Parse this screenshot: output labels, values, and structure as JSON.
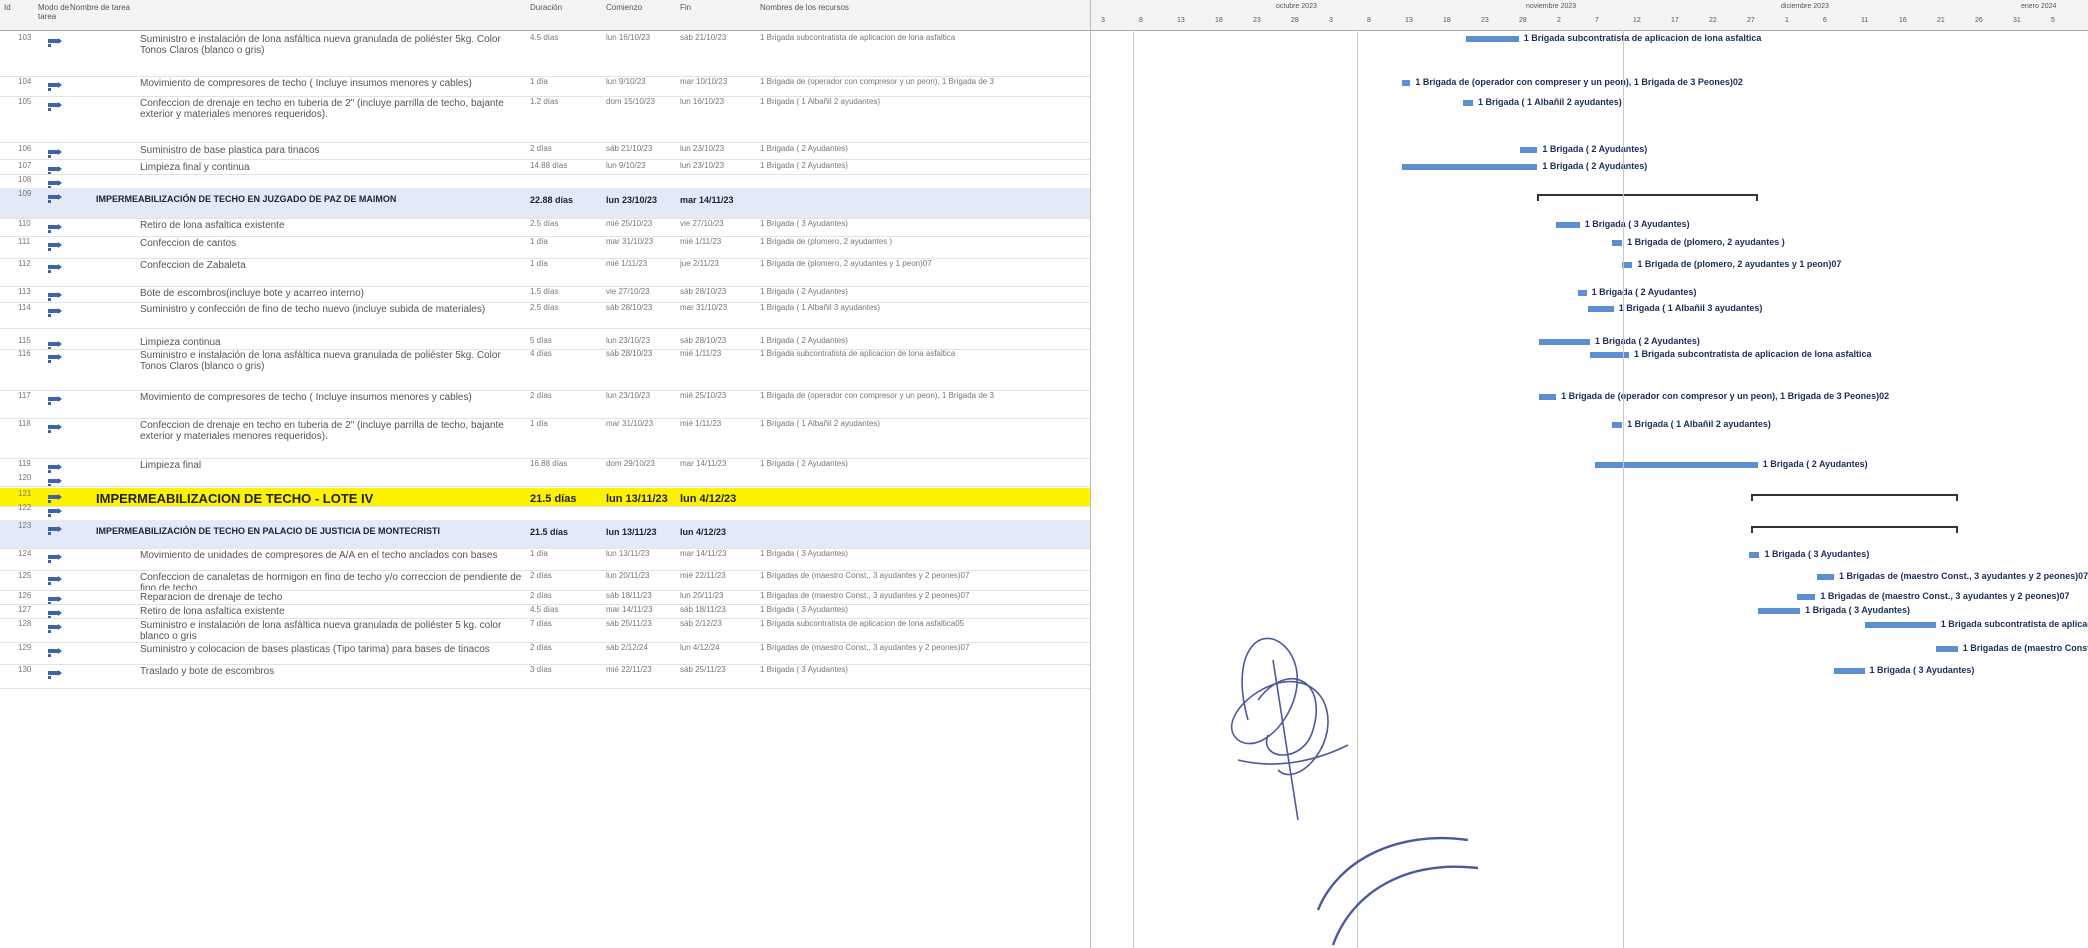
{
  "headers": {
    "id": "Id",
    "mode": "Modo de tarea",
    "name": "Nombre de tarea",
    "duration": "Duración",
    "start": "Comienzo",
    "end": "Fin",
    "resources": "Nombres de los recursos"
  },
  "timeline": {
    "months": [
      "octubre 2023",
      "noviembre 2023",
      "diciembre 2023",
      "enero 2024"
    ],
    "days": [
      "3",
      "8",
      "13",
      "18",
      "23",
      "28",
      "3",
      "8",
      "13",
      "18",
      "23",
      "28",
      "2",
      "7",
      "12",
      "17",
      "22",
      "27",
      "1",
      "6",
      "11",
      "16",
      "21",
      "26",
      "31",
      "5"
    ]
  },
  "rows": [
    {
      "id": "103",
      "name": "Suministro e instalación de lona asfáltica nueva granulada de poliéster 5kg. Color Tonos Claros (blanco o gris)",
      "duration": "4.5 días",
      "start": "lun 16/10/23",
      "end": "sáb 21/10/23",
      "resources": "1 Brigada subcontratista de aplicacion de lona asfaltica",
      "type": "task",
      "bar": [
        0.245,
        0.276
      ],
      "label": "1 Brigada subcontratista de aplicacion de lona asfaltica"
    },
    {
      "id": "104",
      "name": "Movimiento de compresores de techo ( Incluye insumos menores y cables)",
      "duration": "1 día",
      "start": "lun 9/10/23",
      "end": "mar 10/10/23",
      "resources": "1 Brigada de (operador con compresor y un peon), 1 Brigada de 3",
      "type": "task",
      "bar": [
        0.207,
        0.212
      ],
      "label": "1 Brigada de (operador con compreser y un peon), 1 Brigada de 3 Peones)02"
    },
    {
      "id": "105",
      "name": "Confeccion de drenaje en techo en tuberia de 2\" (incluye parrilla de techo, bajante exterior y materiales menores requeridos).",
      "duration": "1.2 días",
      "start": "dom 15/10/23",
      "end": "lun 16/10/23",
      "resources": "1 Brigada ( 1 Albañil 2 ayudantes)",
      "type": "task",
      "bar": [
        0.243,
        0.249
      ],
      "label": "1 Brigada ( 1 Albañil 2 ayudantes)"
    },
    {
      "id": "106",
      "name": "Suministro de base plastica para tinacos",
      "duration": "2 días",
      "start": "sáb 21/10/23",
      "end": "lun 23/10/23",
      "resources": "1 Brigada ( 2 Ayudantes)",
      "type": "task",
      "bar": [
        0.277,
        0.287
      ],
      "label": "1 Brigada ( 2 Ayudantes)"
    },
    {
      "id": "107",
      "name": "Limpieza final y continua",
      "duration": "14.88 días",
      "start": "lun 9/10/23",
      "end": "lun 23/10/23",
      "resources": "1 Brigada ( 2 Ayudantes)",
      "type": "task",
      "bar": [
        0.207,
        0.287
      ],
      "label": "1 Brigada ( 2 Ayudantes)"
    },
    {
      "id": "108",
      "name": "",
      "duration": "",
      "start": "",
      "end": "",
      "resources": "",
      "type": "blank"
    },
    {
      "id": "109",
      "name": "IMPERMEABILIZACIÓN DE TECHO EN JUZGADO DE PAZ DE MAIMON",
      "duration": "22.88 días",
      "start": "lun 23/10/23",
      "end": "mar 14/11/23",
      "resources": "",
      "type": "summary",
      "bar": [
        0.287,
        0.417
      ]
    },
    {
      "id": "110",
      "name": "Retiro de lona asfaltica existente",
      "duration": "2.5 días",
      "start": "mié 25/10/23",
      "end": "vie 27/10/23",
      "resources": "1 Brigada ( 3 Ayudantes)",
      "type": "task",
      "bar": [
        0.298,
        0.312
      ],
      "label": "1 Brigada ( 3 Ayudantes)"
    },
    {
      "id": "111",
      "name": "Confeccion de cantos",
      "duration": "1 día",
      "start": "mar 31/10/23",
      "end": "mié 1/11/23",
      "resources": "1 Brigada de (plomero, 2 ayudantes )",
      "type": "task",
      "bar": [
        0.331,
        0.337
      ],
      "label": "1 Brigada de (plomero, 2 ayudantes )"
    },
    {
      "id": "112",
      "name": "Confeccion de Zabaleta",
      "duration": "1 día",
      "start": "mié 1/11/23",
      "end": "jue 2/11/23",
      "resources": "1 Brigada de (plomero, 2 ayudantes y 1 peon)07",
      "type": "task",
      "bar": [
        0.337,
        0.343
      ],
      "label": "1 Brigada de (plomero, 2 ayudantes y 1 peon)07"
    },
    {
      "id": "113",
      "name": "Bote de escombros(incluye bote y acarreo interno)",
      "duration": "1.5 días",
      "start": "vie 27/10/23",
      "end": "sáb 28/10/23",
      "resources": "1 Brigada ( 2 Ayudantes)",
      "type": "task",
      "bar": [
        0.311,
        0.316
      ],
      "label": "1 Brigada ( 2 Ayudantes)"
    },
    {
      "id": "114",
      "name": "Suministro y confección de fino de techo nuevo (incluye subida de materiales)",
      "duration": "2.5 días",
      "start": "sáb 28/10/23",
      "end": "mar 31/10/23",
      "resources": "1 Brigada ( 1 Albañil 3 ayudantes)",
      "type": "task",
      "bar": [
        0.317,
        0.332
      ],
      "label": "1 Brigada ( 1 Albañil 3 ayudantes)"
    },
    {
      "id": "115",
      "name": "Limpieza continua",
      "duration": "5 días",
      "start": "lun 23/10/23",
      "end": "sáb 28/10/23",
      "resources": "1 Brigada ( 2 Ayudantes)",
      "type": "task",
      "bar": [
        0.288,
        0.318
      ],
      "label": "1 Brigada ( 2 Ayudantes)"
    },
    {
      "id": "116",
      "name": "Suministro e instalación de lona asfáltica nueva granulada de poliéster 5kg. Color Tonos Claros (blanco o gris)",
      "duration": "4 días",
      "start": "sáb 28/10/23",
      "end": "mié 1/11/23",
      "resources": "1 Brigada subcontratista de aplicacion de lona asfaltica",
      "type": "task",
      "bar": [
        0.318,
        0.341
      ],
      "label": "1 Brigada subcontratista de aplicacion de lona asfaltica"
    },
    {
      "id": "117",
      "name": "Movimiento de compresores de techo ( Incluye insumos menores y cables)",
      "duration": "2 días",
      "start": "lun 23/10/23",
      "end": "mié 25/10/23",
      "resources": "1 Brigada de (operador con compresor y un peon), 1 Brigada de 3",
      "type": "task",
      "bar": [
        0.288,
        0.298
      ],
      "label": "1 Brigada de (operador con compresor y un peon), 1 Brigada de 3 Peones)02"
    },
    {
      "id": "118",
      "name": "Confeccion de drenaje en techo en tuberia de 2\" (incluye parrilla de techo, bajante exterior y materiales menores requeridos).",
      "duration": "1 día",
      "start": "mar 31/10/23",
      "end": "mié 1/11/23",
      "resources": "1 Brigada ( 1 Albañil 2 ayudantes)",
      "type": "task",
      "bar": [
        0.331,
        0.337
      ],
      "label": "1 Brigada ( 1 Albañil 2 ayudantes)"
    },
    {
      "id": "119",
      "name": "Limpieza final",
      "duration": "16.88 días",
      "start": "dom 29/10/23",
      "end": "mar 14/11/23",
      "resources": "1 Brigada ( 2 Ayudantes)",
      "type": "task",
      "bar": [
        0.321,
        0.417
      ],
      "label": "1 Brigada ( 2 Ayudantes)"
    },
    {
      "id": "120",
      "name": "",
      "duration": "",
      "start": "",
      "end": "",
      "resources": "",
      "type": "blank"
    },
    {
      "id": "121",
      "name": "IMPERMEABILIZACION DE TECHO - LOTE IV",
      "duration": "21.5 días",
      "start": "lun 13/11/23",
      "end": "lun 4/12/23",
      "resources": "",
      "type": "lote",
      "bar": [
        0.413,
        0.535
      ]
    },
    {
      "id": "122",
      "name": "",
      "duration": "",
      "start": "",
      "end": "",
      "resources": "",
      "type": "blank"
    },
    {
      "id": "123",
      "name": "IMPERMEABILIZACIÓN DE TECHO EN PALACIO DE JUSTICIA DE MONTECRISTI",
      "duration": "21.5 días",
      "start": "lun 13/11/23",
      "end": "lun 4/12/23",
      "resources": "",
      "type": "summary",
      "bar": [
        0.413,
        0.535
      ]
    },
    {
      "id": "124",
      "name": "Movimiento de unidades de compresores de A/A en el techo anclados con bases",
      "duration": "1 día",
      "start": "lun 13/11/23",
      "end": "mar 14/11/23",
      "resources": "1 Brigada ( 3 Ayudantes)",
      "type": "task",
      "bar": [
        0.412,
        0.418
      ],
      "label": "1 Brigada ( 3 Ayudantes)"
    },
    {
      "id": "125",
      "name": "Confeccion de canaletas de hormigon en fino de techo y/o correccion de pendiente de fino de techo",
      "duration": "2 días",
      "start": "lun 20/11/23",
      "end": "mié 22/11/23",
      "resources": "1 Brigadas de (maestro Const., 3 ayudantes y 2 peones)07",
      "type": "task",
      "bar": [
        0.452,
        0.462
      ],
      "label": "1 Brigadas de (maestro Const., 3 ayudantes y 2 peones)07"
    },
    {
      "id": "126",
      "name": "Reparacion de drenaje de techo",
      "duration": "2 días",
      "start": "sáb 18/11/23",
      "end": "lun 20/11/23",
      "resources": "1 Brigadas de (maestro Const., 3 ayudantes y 2 peones)07",
      "type": "task",
      "bar": [
        0.44,
        0.451
      ],
      "label": "1 Brigadas de (maestro Const., 3 ayudantes y 2 peones)07"
    },
    {
      "id": "127",
      "name": "Retiro de lona asfaltica existente",
      "duration": "4.5 días",
      "start": "mar 14/11/23",
      "end": "sáb 18/11/23",
      "resources": "1 Brigada ( 3 Ayudantes)",
      "type": "task",
      "bar": [
        0.417,
        0.442
      ],
      "label": "1 Brigada ( 3 Ayudantes)"
    },
    {
      "id": "128",
      "name": "Suministro e instalación de lona asfáltica nueva granulada de poliéster 5 kg. color blanco o gris",
      "duration": "7 días",
      "start": "sáb 25/11/23",
      "end": "sáb 2/12/23",
      "resources": "1 Brigada subcontratista de aplicacion de lona asfaltica05",
      "type": "task",
      "bar": [
        0.48,
        0.522
      ],
      "label": "1 Brigada subcontratista de aplicacion de lona"
    },
    {
      "id": "129",
      "name": "Suministro y colocacion de bases plasticas (Tipo tarima) para bases de tinacos",
      "duration": "2 días",
      "start": "sáb 2/12/24",
      "end": "lun 4/12/24",
      "resources": "1 Brigadas de (maestro Const., 3 ayudantes y 2 peones)07",
      "type": "task",
      "bar": [
        0.522,
        0.535
      ],
      "label": "1 Brigadas de (maestro Const., 3 ayudantes )"
    },
    {
      "id": "130",
      "name": "Traslado y bote de escombros",
      "duration": "3 días",
      "start": "mié 22/11/23",
      "end": "sáb 25/11/23",
      "resources": "1 Brigada ( 3 Ayudantes)",
      "type": "task",
      "bar": [
        0.462,
        0.48
      ],
      "label": "1 Brigada ( 3 Ayudantes)"
    }
  ],
  "colors": {
    "bar": "#5b8fd1",
    "summary_band": "#e3e9f7",
    "lote_band": "#fff200",
    "stamp": "#4a5a9c"
  }
}
